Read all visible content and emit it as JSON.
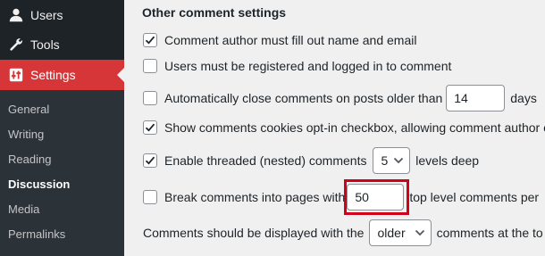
{
  "sidebar": {
    "users_label": "Users",
    "tools_label": "Tools",
    "settings_label": "Settings",
    "submenu": [
      "General",
      "Writing",
      "Reading",
      "Discussion",
      "Media",
      "Permalinks"
    ]
  },
  "section_title": "Other comment settings",
  "settings": {
    "require_name_email": {
      "label": "Comment author must fill out name and email",
      "checked": true
    },
    "registration_required": {
      "label": "Users must be registered and logged in to comment",
      "checked": false
    },
    "close_comments": {
      "label_before": "Automatically close comments on posts older than",
      "value": "14",
      "label_after": "days",
      "checked": false
    },
    "cookies_opt_in": {
      "label": "Show comments cookies opt-in checkbox, allowing comment author c",
      "checked": true
    },
    "thread_comments": {
      "label_before": "Enable threaded (nested) comments",
      "value": "5",
      "label_after": "levels deep",
      "checked": true
    },
    "page_comments": {
      "label_before": "Break comments into pages with",
      "value": "50",
      "label_after": "top level comments per",
      "checked": false
    },
    "default_page": {
      "label_before": "Comments should be displayed with the",
      "value": "older",
      "label_after": "comments at the to"
    }
  }
}
